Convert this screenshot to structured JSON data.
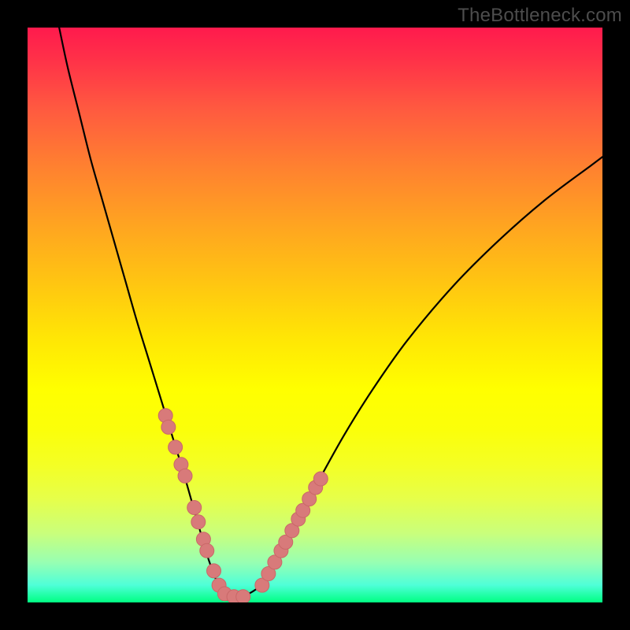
{
  "watermark": "TheBottleneck.com",
  "colors": {
    "background": "#000000",
    "curve": "#000000",
    "marker_fill": "#d87a7a",
    "marker_stroke": "#c96868",
    "gradient_top": "#ff1a4d",
    "gradient_bottom": "#00ff82"
  },
  "chart_data": {
    "type": "line",
    "title": "",
    "xlabel": "",
    "ylabel": "",
    "xlim": [
      0,
      100
    ],
    "ylim": [
      0,
      100
    ],
    "grid": false,
    "legend": false,
    "series": [
      {
        "name": "bottleneck-curve",
        "x": [
          5.5,
          7,
          9,
          11,
          13,
          15,
          17,
          19,
          21,
          23,
          25,
          27,
          29,
          30,
          31,
          32,
          33,
          34,
          35,
          37,
          39,
          41,
          43,
          46,
          50,
          55,
          60,
          66,
          74,
          82,
          90,
          98,
          100
        ],
        "y": [
          100,
          93,
          85,
          77,
          70,
          63,
          56,
          49,
          42.5,
          36,
          29.5,
          23,
          16,
          12.5,
          9,
          6,
          3.5,
          2,
          1,
          1,
          1.8,
          3.5,
          7,
          12.5,
          20,
          29,
          37,
          45.5,
          55,
          63,
          70,
          76,
          77.5
        ]
      }
    ],
    "markers": {
      "name": "highlighted-points",
      "x_approx": [
        24.0,
        24.5,
        25.7,
        26.7,
        27.4,
        29.0,
        29.7,
        30.6,
        31.2,
        32.4,
        33.3,
        34.3,
        35.9,
        37.5,
        40.8,
        41.9,
        43.0,
        44.1,
        44.9,
        46.0,
        47.1,
        47.9,
        49.0,
        50.1,
        51.0
      ],
      "y_approx": [
        32.5,
        30.5,
        27.0,
        24.0,
        22.0,
        16.5,
        14.0,
        11.0,
        9.0,
        5.5,
        3.0,
        1.5,
        1.0,
        1.0,
        3.0,
        5.0,
        7.0,
        9.0,
        10.5,
        12.5,
        14.5,
        16.0,
        18.0,
        20.0,
        21.5
      ]
    }
  }
}
